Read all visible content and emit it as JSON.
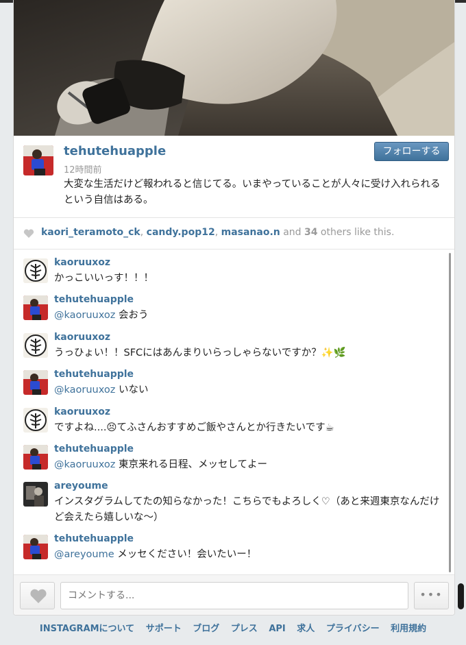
{
  "post": {
    "username": "tehutehuapple",
    "time_ago": "12時間前",
    "caption": "大変な生活だけど報われると信じてる。いまやっていることが人々に受け入れられるという自信はある。",
    "follow_label": "フォローする"
  },
  "likes": {
    "users": [
      "kaori_teramoto_ck",
      "candy.pop12",
      "masanao.n"
    ],
    "separator": ", ",
    "and_text": " and ",
    "count": "34",
    "others_text": " others like this."
  },
  "comments": [
    {
      "user": "kaoruuxoz",
      "mention": "",
      "text": "かっこいいっす！！！",
      "avatar": "tree-avatar"
    },
    {
      "user": "tehutehuapple",
      "mention": "@kaoruuxoz",
      "text": " 会おう",
      "avatar": "person-avatar"
    },
    {
      "user": "kaoruuxoz",
      "mention": "",
      "text": "うっひょい！！SFCにはあんまりいらっしゃらないですか？✨🌿",
      "avatar": "tree-avatar"
    },
    {
      "user": "tehutehuapple",
      "mention": "@kaoruuxoz",
      "text": " いない",
      "avatar": "person-avatar"
    },
    {
      "user": "kaoruuxoz",
      "mention": "",
      "text": "ですよね....😣てふさんおすすめご飯やさんとか行きたいです☕",
      "avatar": "tree-avatar"
    },
    {
      "user": "tehutehuapple",
      "mention": "@kaoruuxoz",
      "text": " 東京来れる日程、メッセしてよー",
      "avatar": "person-avatar"
    },
    {
      "user": "areyoume",
      "mention": "",
      "text": "インスタグラムしてたの知らなかった！こちらでもよろしく♡（あと来週東京なんだけど会えたら嬉しいな〜）",
      "avatar": "dark-avatar"
    },
    {
      "user": "tehutehuapple",
      "mention": "@areyoume",
      "text": " メッセください！会いたいー！",
      "avatar": "person-avatar"
    }
  ],
  "comment_bar": {
    "placeholder": "コメントする...",
    "more_label": "•••"
  },
  "footer": {
    "links": [
      "INSTAGRAMについて",
      "サポート",
      "ブログ",
      "プレス",
      "API",
      "求人",
      "プライバシー",
      "利用規約"
    ]
  },
  "colors": {
    "accent": "#3f729b",
    "top_accent": "#c13ad6"
  }
}
